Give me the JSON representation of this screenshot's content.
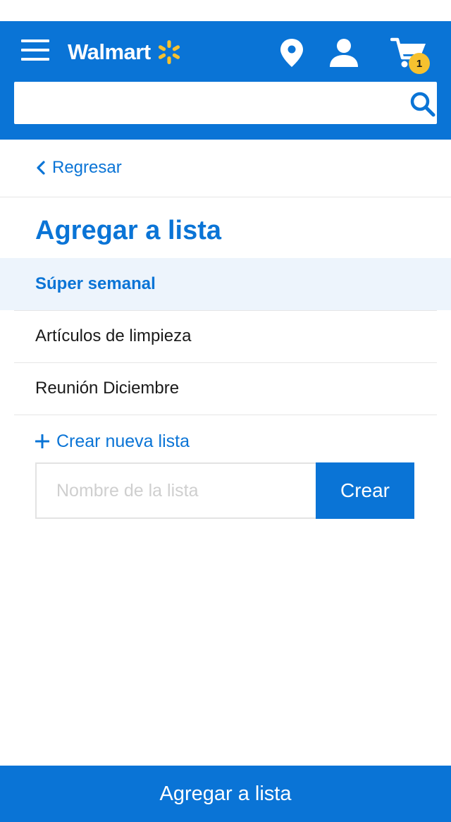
{
  "header": {
    "brand": "Walmart",
    "cart_count": "1",
    "search": {
      "value": "",
      "placeholder": ""
    },
    "icons": [
      "menu-icon",
      "walmart-spark-icon",
      "location-pin-icon",
      "user-icon",
      "cart-icon",
      "search-icon"
    ]
  },
  "nav": {
    "back_label": "Regresar"
  },
  "main": {
    "title": "Agregar a lista",
    "lists": [
      {
        "label": "Súper semanal",
        "selected": true
      },
      {
        "label": "Artículos de limpieza",
        "selected": false
      },
      {
        "label": "Reunión Diciembre",
        "selected": false
      }
    ],
    "create_link_label": "Crear nueva lista",
    "new_list": {
      "value": "",
      "placeholder": "Nombre de la lista"
    },
    "create_button_label": "Crear"
  },
  "footer": {
    "button_label": "Agregar a lista"
  },
  "colors": {
    "brand_blue": "#0a74d6",
    "spark_yellow": "#f6c12f",
    "selected_bg": "#edf4fc"
  }
}
